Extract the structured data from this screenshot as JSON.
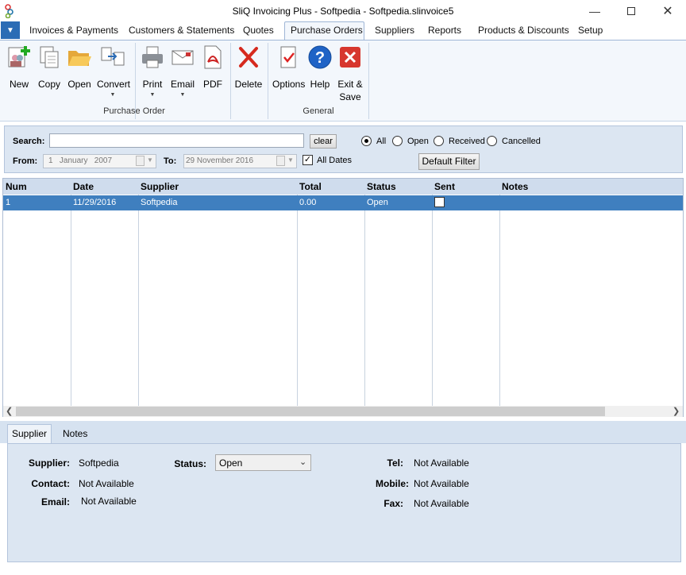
{
  "window": {
    "title": "SliQ Invoicing Plus - Softpedia - Softpedia.slinvoice5"
  },
  "menu": {
    "tabs": [
      "Invoices & Payments",
      "Customers & Statements",
      "Quotes",
      "Purchase Orders",
      "Suppliers",
      "Reports",
      "Products & Discounts",
      "Setup"
    ],
    "active": "Purchase Orders"
  },
  "ribbon": {
    "buttons": {
      "new": "New",
      "copy": "Copy",
      "open": "Open",
      "convert": "Convert",
      "print": "Print",
      "email": "Email",
      "pdf": "PDF",
      "delete": "Delete",
      "options": "Options",
      "help": "Help",
      "exit": "Exit &",
      "exit2": "Save"
    },
    "groups": {
      "purchase_order": "Purchase Order",
      "general": "General"
    },
    "icons": [
      "new-document-icon",
      "copy-icon",
      "folder-open-icon",
      "convert-icon",
      "printer-icon",
      "email-icon",
      "pdf-icon",
      "delete-x-icon",
      "options-checklist-icon",
      "help-question-icon",
      "exit-save-icon"
    ]
  },
  "filter": {
    "search_label": "Search:",
    "search_value": "",
    "clear": "clear",
    "from_label": "From:",
    "from_date": "1   January   2007",
    "to_label": "To:",
    "to_date": "29 November 2016",
    "all_dates": "All Dates",
    "all_dates_checked": true,
    "radios": [
      "All",
      "Open",
      "Received",
      "Cancelled"
    ],
    "selected_radio": "All",
    "default_filter": "Default Filter"
  },
  "table": {
    "columns": [
      "Num",
      "Date",
      "Supplier",
      "Total",
      "Status",
      "Sent",
      "Notes"
    ],
    "rows": [
      {
        "num": "1",
        "date": "11/29/2016",
        "supplier": "Softpedia",
        "total": "0.00",
        "status": "Open",
        "sent": false,
        "notes": ""
      }
    ]
  },
  "details": {
    "tabs": [
      "Supplier",
      "Notes"
    ],
    "active_tab": "Supplier",
    "supplier_label": "Supplier:",
    "supplier": "Softpedia",
    "contact_label": "Contact:",
    "contact": "Not Available",
    "email_label": "Email:",
    "email": "Not Available",
    "status_label": "Status:",
    "status": "Open",
    "tel_label": "Tel:",
    "tel": "Not Available",
    "mobile_label": "Mobile:",
    "mobile": "Not Available",
    "fax_label": "Fax:",
    "fax": "Not Available"
  },
  "colors": {
    "accent": "#2b6cb5",
    "selection": "#3f7fbf",
    "panel": "#dce6f2"
  }
}
